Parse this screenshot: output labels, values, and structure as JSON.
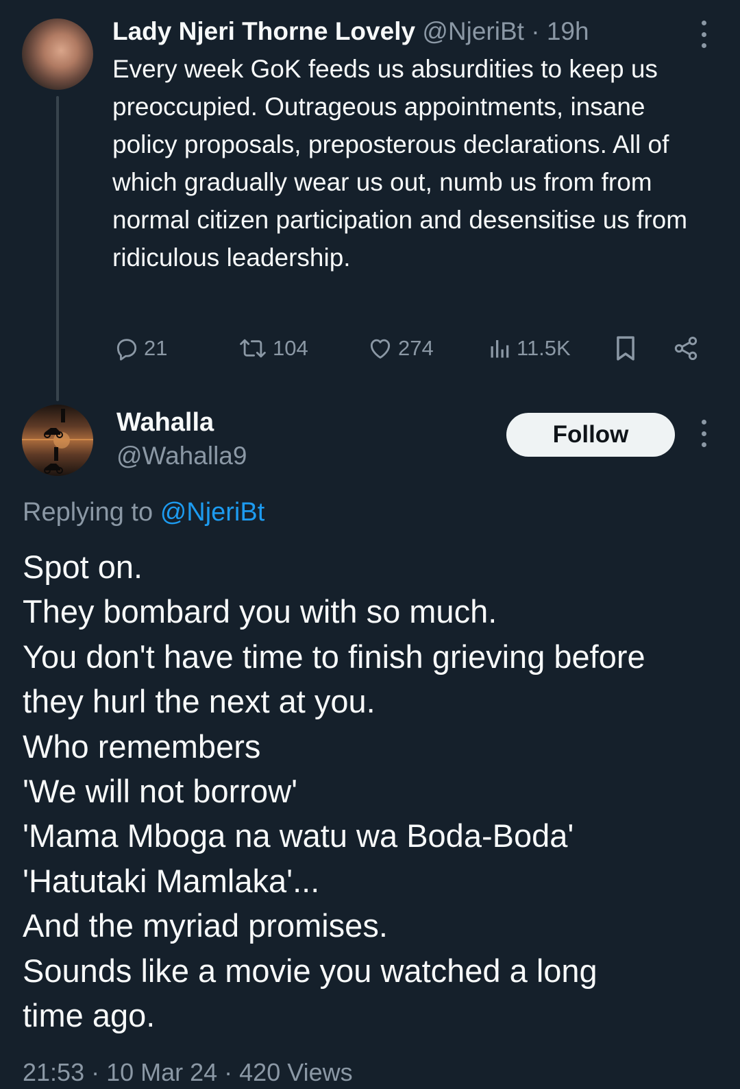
{
  "parent_tweet": {
    "author_name": "Lady Njeri Thorne Lovely",
    "author_handle": "@NjeriBt",
    "separator": "·",
    "time": "19h",
    "text": "Every week GoK feeds us absurdities to keep us preoccupied. Outrageous appointments, insane policy proposals, preposterous declarations. All of which gradually wear us out, numb us from from normal citizen participation and desensitise us from ridiculous leadership.",
    "reply_count": "21",
    "retweet_count": "104",
    "like_count": "274",
    "view_count": "11.5K"
  },
  "reply_tweet": {
    "author_name": "Wahalla",
    "author_handle": "@Wahalla9",
    "follow_label": "Follow",
    "replying_prefix": "Replying to",
    "replying_to": "@NjeriBt",
    "lines": [
      "Spot on.",
      "They bombard you with so much.",
      "You don't have time to finish grieving before",
      "they hurl the next at you.",
      "Who remembers",
      "'We will not borrow'",
      "'Mama Mboga na watu wa Boda-Boda'",
      "'Hatutaki Mamlaka'...",
      "And the myriad promises.",
      "Sounds like a movie you watched a long",
      "time ago."
    ],
    "footer": "21:53 · 10 Mar 24 · 420 Views"
  },
  "colors": {
    "background": "#15202b",
    "text_primary": "#f7f9f9",
    "text_secondary": "#8b98a5",
    "link": "#1d9bf0",
    "follow_button_bg": "#eff3f4"
  },
  "icons": {
    "reply": "reply-icon",
    "retweet": "retweet-icon",
    "like": "heart-icon",
    "views": "views-icon",
    "bookmark": "bookmark-icon",
    "share": "share-icon",
    "more": "more-vertical-icon"
  }
}
